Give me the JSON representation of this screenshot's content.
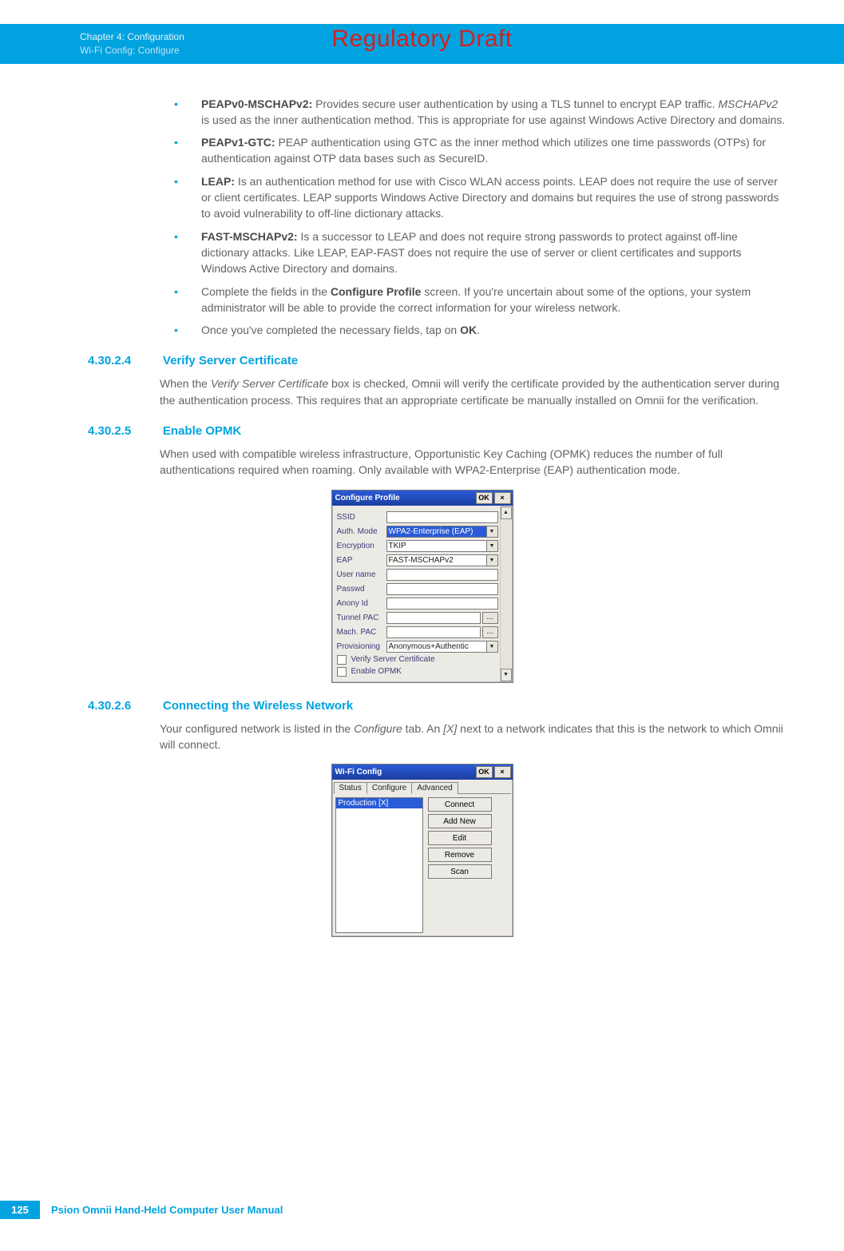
{
  "watermark": "Regulatory Draft",
  "header": {
    "line1": "Chapter 4:  Configuration",
    "line2": "Wi-Fi Config: Configure"
  },
  "bullets": {
    "b1_term": "PEAPv0-MSCHAPv2:",
    "b1_text": " Provides secure user authentication by using a TLS tunnel to encrypt EAP traffic. ",
    "b1_i": "MSCHAPv2",
    "b1_text2": " is used as the inner authentication method. This is appropriate for use against Windows Active Directory and domains.",
    "b2_term": "PEAPv1-GTC:",
    "b2_text": " PEAP authentication using GTC as the inner method which utilizes one time passwords (OTPs) for authentication against OTP data bases such as SecureID.",
    "b3_term": "LEAP:",
    "b3_text": " Is an authentication method for use with Cisco WLAN access points. LEAP does not require the use of server or client certificates. LEAP supports Windows Active Directory and domains but requires the use of strong passwords to avoid vulnerability to off-line dictionary attacks.",
    "b4_term": "FAST-MSCHAPv2:",
    "b4_text": " Is a successor to LEAP and does not require strong passwords to protect against off-line dictionary attacks. Like LEAP, EAP-FAST does not require the use of server or client certificates and supports Windows Active Directory and domains.",
    "b5_pre": "Complete the fields in the ",
    "b5_b": "Configure Profile",
    "b5_post": " screen. If you're uncertain about some of the options, your system administrator will be able to provide the correct information for your wireless network.",
    "b6_pre": "Once you've completed the necessary fields, tap on ",
    "b6_b": "OK",
    "b6_post": "."
  },
  "sec4": {
    "num": "4.30.2.4",
    "title": "Verify Server Certificate",
    "p_pre": "When the ",
    "p_i": "Verify Server Certificate",
    "p_post": " box is checked, Omnii will verify the certificate provided by the authentication server during the authentication process. This requires that an appropriate certificate be manually installed on Omnii for the verification."
  },
  "sec5": {
    "num": "4.30.2.5",
    "title": "Enable OPMK",
    "p": "When used with compatible wireless infrastructure, Opportunistic Key Caching (OPMK) reduces the number of full authentications required when roaming. Only available with WPA2-Enterprise (EAP) authentication mode."
  },
  "configProfile": {
    "title": "Configure Profile",
    "ok": "OK",
    "close": "×",
    "labels": {
      "ssid": "SSID",
      "auth": "Auth. Mode",
      "enc": "Encryption",
      "eap": "EAP",
      "user": "User name",
      "pwd": "Passwd",
      "anon": "Anony Id",
      "tpac": "Tunnel PAC",
      "mpac": "Mach. PAC",
      "prov": "Provisioning"
    },
    "values": {
      "auth": "WPA2-Enterprise (EAP)",
      "enc": "TKIP",
      "eap": "FAST-MSCHAPv2",
      "prov": "Anonymous+Authentic",
      "dots": "..."
    },
    "checks": {
      "vsc": "Verify Server Certificate",
      "opmk": "Enable OPMK"
    }
  },
  "sec6": {
    "num": "4.30.2.6",
    "title": "Connecting the Wireless Network",
    "p_pre": "Your configured network is listed in the ",
    "p_i1": "Configure",
    "p_mid": " tab. An ",
    "p_i2": "[X]",
    "p_post": " next to a network indicates that this is the network to which Omnii will connect."
  },
  "wifiConfig": {
    "title": "Wi-Fi Config",
    "ok": "OK",
    "close": "×",
    "tabs": {
      "status": "Status",
      "configure": "Configure",
      "advanced": "Advanced"
    },
    "item": "Production [X]",
    "buttons": {
      "connect": "Connect",
      "add": "Add New",
      "edit": "Edit",
      "remove": "Remove",
      "scan": "Scan"
    }
  },
  "footer": {
    "page": "125",
    "title": "Psion Omnii Hand-Held Computer User Manual"
  }
}
